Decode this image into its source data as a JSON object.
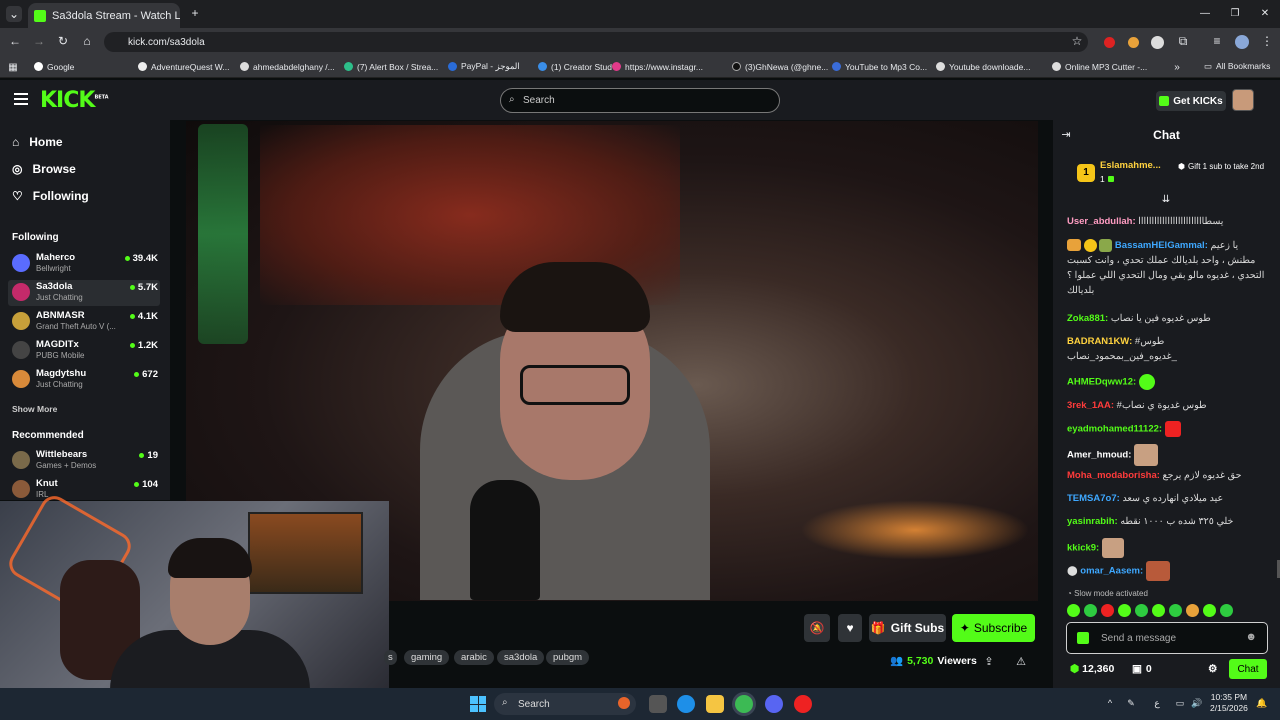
{
  "browser": {
    "tab_title": "Sa3dola Stream - Watch Liv",
    "url": "kick.com/sa3dola",
    "bookmarks": [
      "Google",
      "AdventureQuest W...",
      "ahmedabdelghany /...",
      "(7) Alert Box / Strea...",
      "PayPal - الموجز",
      "(1) Creator Studio",
      "https://www.instagr...",
      "(3)GhNewa (@ghne...",
      "YouTube to Mp3 Co...",
      "Youtube downloade...",
      "Online MP3 Cutter -..."
    ],
    "all_bookmarks": "All Bookmarks"
  },
  "header": {
    "logo": "KICK",
    "logo_badge": "BETA",
    "search_placeholder": "Search",
    "get_kicks": "Get KICKs"
  },
  "sidebar": {
    "nav": [
      {
        "label": "Home",
        "icon": "home-icon"
      },
      {
        "label": "Browse",
        "icon": "compass-icon"
      },
      {
        "label": "Following",
        "icon": "heart-icon"
      }
    ],
    "following_title": "Following",
    "following": [
      {
        "name": "Maherco",
        "category": "Bellwright",
        "viewers": "39.4K",
        "color": "#5a6cff"
      },
      {
        "name": "Sa3dola",
        "category": "Just Chatting",
        "viewers": "5.7K",
        "color": "#c42a6a"
      },
      {
        "name": "ABNMASR",
        "category": "Grand Theft Auto V (...",
        "viewers": "4.1K",
        "color": "#c7a03a"
      },
      {
        "name": "MAGDITx",
        "category": "PUBG Mobile",
        "viewers": "1.2K",
        "color": "#444444"
      },
      {
        "name": "Magdytshu",
        "category": "Just Chatting",
        "viewers": "672",
        "color": "#d88a3a"
      }
    ],
    "show_more": "Show More",
    "recommended_title": "Recommended",
    "recommended": [
      {
        "name": "Wittlebears",
        "category": "Games + Demos",
        "viewers": "19",
        "color": "#7a6a4a"
      },
      {
        "name": "Knut",
        "category": "IRL",
        "viewers": "104",
        "color": "#8a5a3a"
      }
    ]
  },
  "stream": {
    "gift_subs": "Gift Subs",
    "subscribe": "Subscribe",
    "tags": [
      "gaming",
      "arabic",
      "sa3dola",
      "pubgm"
    ],
    "viewers_count": "5,730",
    "viewers_label": "Viewers"
  },
  "chat": {
    "title": "Chat",
    "pinned_user": "Eslamahme...",
    "pinned_rank": "1",
    "pinned_count": "1",
    "gift_prompt": "Gift 1 sub to take 2nd",
    "messages": [
      {
        "user": "User_abdullah:",
        "color": "#ff9cc2",
        "text": "يسطااااااااااااااااااااااااا"
      },
      {
        "user": "BassamHElGammal:",
        "color": "#3ea8ff",
        "text": "يا زعيم مطنش ، واحد بلديالك عملك تحدي ، وانت كسبت التحدي ، غديوه مالو بقي ومال التحدي اللي عملوا ؟ بلديالك"
      },
      {
        "user": "Zoka881:",
        "color": "#53fc18",
        "text": "طوس غديوه فين يا نصاب"
      },
      {
        "user": "BADRAN1KW:",
        "color": "#ffd23f",
        "text": "#طوس _غديوه_فين_بمحمود_نصاب"
      },
      {
        "user": "AHMEDqww12:",
        "color": "#53fc18",
        "text": ""
      },
      {
        "user": "3rek_1AA:",
        "color": "#ff3b3b",
        "text": "#طوس غديوة ي نصاب"
      },
      {
        "user": "eyadmohamed11122:",
        "color": "#53fc18",
        "text": ""
      },
      {
        "user": "Amer_hmoud:",
        "color": "#ffffff",
        "text": ""
      },
      {
        "user": "Moha_modaborisha:",
        "color": "#ff3b3b",
        "text": "حق غديوه لازم يرجع"
      },
      {
        "user": "TEMSA7o7:",
        "color": "#3ea8ff",
        "text": "عيد ميلادي انهارده ي سعد"
      },
      {
        "user": "yasinrabih:",
        "color": "#53fc18",
        "text": "خلي ٣٢٥ شده ب ١٠٠٠ نقطه"
      },
      {
        "user": "kkick9:",
        "color": "#53fc18",
        "text": ""
      },
      {
        "user": "omar_Aasem:",
        "color": "#3ea8ff",
        "text": ""
      }
    ],
    "slow_mode": "Slow mode activated",
    "input_placeholder": "Send a message",
    "kicks_balance": "12,360",
    "points": "0",
    "chat_button": "Chat"
  },
  "taskbar": {
    "search": "Search",
    "time": "10:35 PM",
    "date": "2/15/2026"
  },
  "colors": {
    "accent": "#53fc18",
    "bg": "#0b0e0f",
    "panel": "#191b1f"
  }
}
